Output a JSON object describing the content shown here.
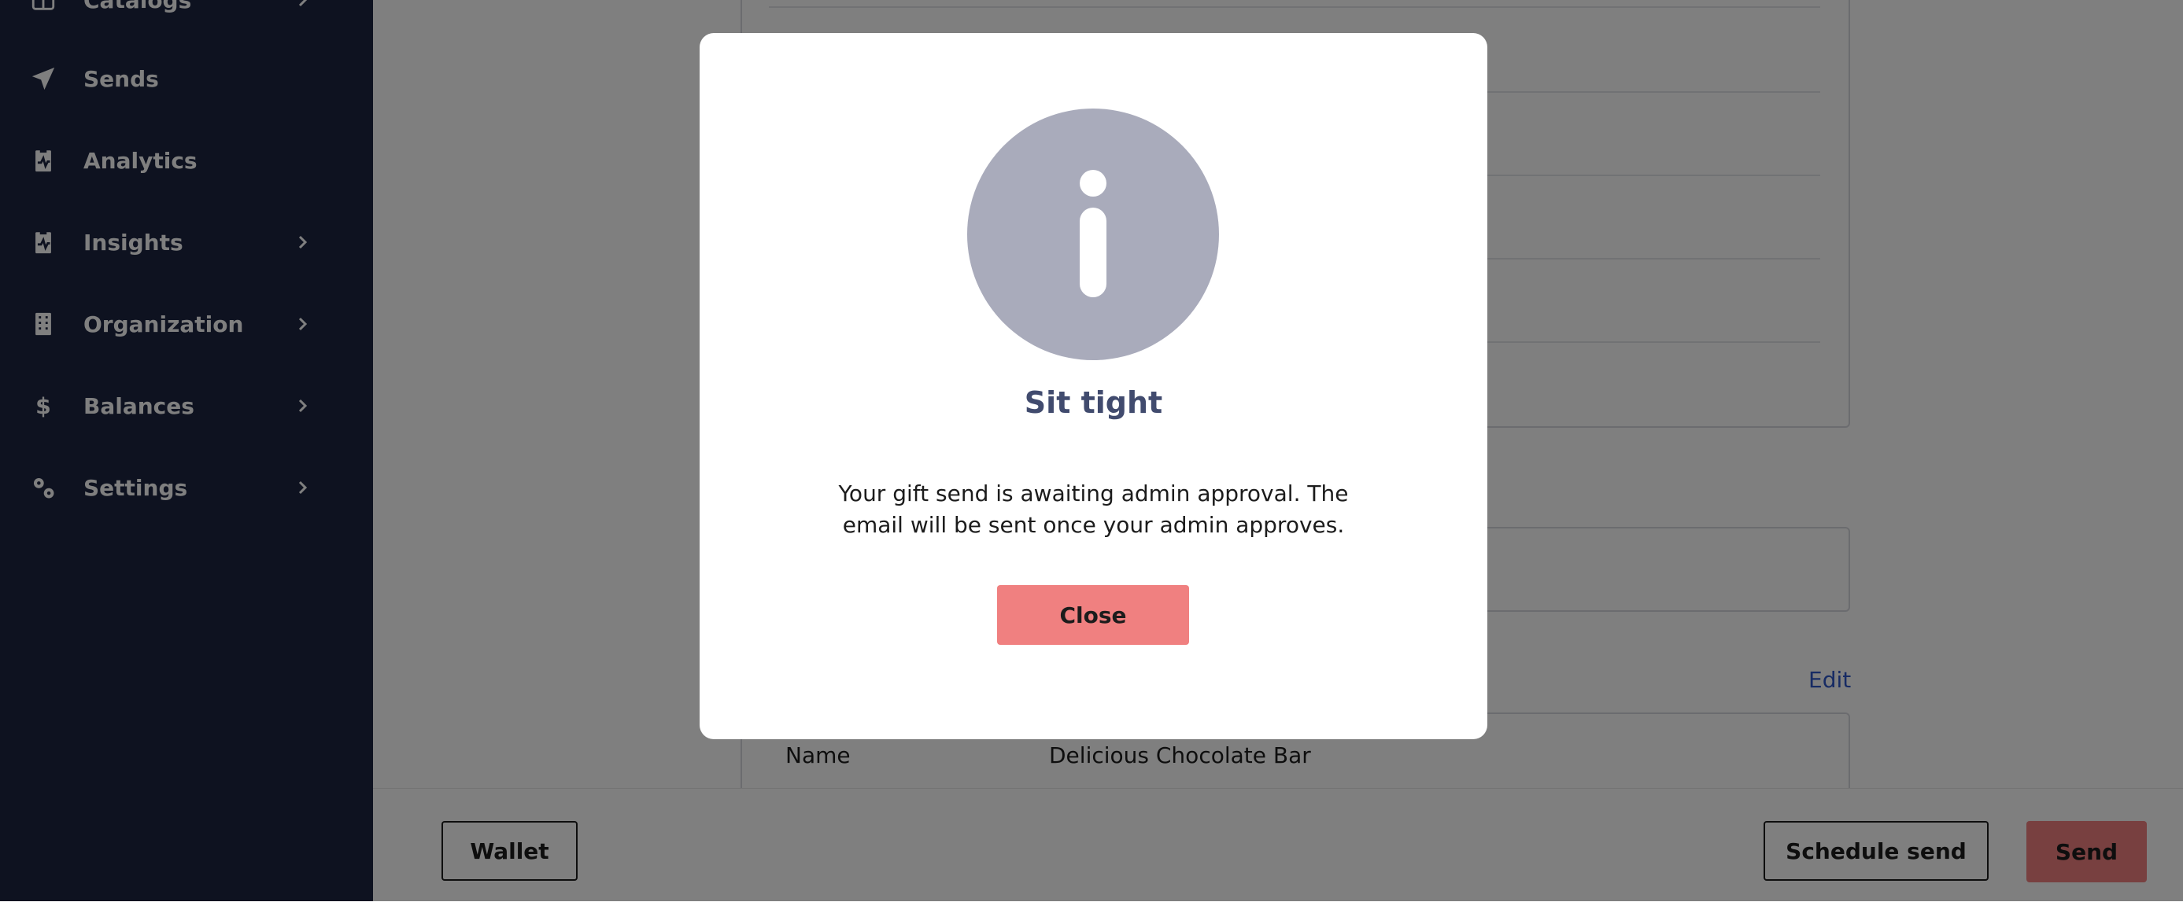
{
  "sidebar": {
    "items": [
      {
        "label": "Catalogs",
        "icon": "catalog-icon",
        "has_chevron": true
      },
      {
        "label": "Sends",
        "icon": "paper-plane-icon",
        "has_chevron": false
      },
      {
        "label": "Analytics",
        "icon": "clipboard-pulse-icon",
        "has_chevron": false
      },
      {
        "label": "Insights",
        "icon": "clipboard-pulse-icon",
        "has_chevron": true
      },
      {
        "label": "Organization",
        "icon": "building-icon",
        "has_chevron": true
      },
      {
        "label": "Balances",
        "icon": "dollar-icon",
        "has_chevron": true
      },
      {
        "label": "Settings",
        "icon": "gears-icon",
        "has_chevron": true
      }
    ]
  },
  "main": {
    "edit_label": "Edit",
    "detail": {
      "key": "Name",
      "value": "Delicious Chocolate Bar"
    }
  },
  "footer": {
    "wallet_label": "Wallet",
    "schedule_label": "Schedule send",
    "send_label": "Send"
  },
  "modal": {
    "icon": "info-icon",
    "title": "Sit tight",
    "message": "Your gift send is awaiting admin approval. The email will be sent once your admin approves.",
    "close_label": "Close"
  },
  "colors": {
    "sidebar_bg": "#1c2541",
    "accent": "#f08080",
    "title_color": "#414b6e",
    "link": "#2f57c8",
    "info_circle": "#a9abbb"
  }
}
